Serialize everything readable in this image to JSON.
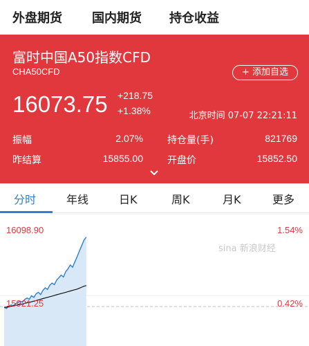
{
  "nav": {
    "tabs": [
      "外盘期货",
      "国内期货",
      "持仓收益"
    ]
  },
  "instrument": {
    "name": "富时中国A50指数CFD",
    "code": "CHA50CFD",
    "add_label": "+ 添加自选",
    "price": "16073.75",
    "change": "+218.75",
    "change_pct": "+1.38%",
    "time": "北京时间 07-07 22:21:11"
  },
  "stats": [
    {
      "label": "振幅",
      "value": "2.07%"
    },
    {
      "label": "持仓量(手)",
      "value": "821769"
    },
    {
      "label": "昨结算",
      "value": "15855.00"
    },
    {
      "label": "开盘价",
      "value": "15852.50"
    }
  ],
  "chart_tabs": [
    "分时",
    "年线",
    "日K",
    "周K",
    "月K",
    "更多"
  ],
  "chart_data": {
    "type": "line",
    "title": "",
    "xlabel": "",
    "ylabel": "",
    "ylim": [
      15744,
      16098.9
    ],
    "y_ticks_left": [
      "16098.90",
      "15921.25"
    ],
    "y_ticks_right": [
      "1.54%",
      "0.42%"
    ],
    "reference_value": 15855.0,
    "series": [
      {
        "values": [
          15852.5,
          15849,
          15856,
          15860,
          15858,
          15864,
          15868,
          15872,
          15869,
          15877,
          15882,
          15878,
          15889,
          15884,
          15895,
          15900,
          15893,
          15906,
          15914,
          15909,
          15922,
          15929,
          15924,
          15938,
          15946,
          15954,
          15948,
          15965,
          15974,
          15986,
          15979,
          15996,
          16012,
          16030,
          16047,
          16064,
          16073.75
        ]
      },
      {
        "values": [
          15852.5,
          15853,
          15854,
          15856,
          15857,
          15859,
          15860,
          15862,
          15863,
          15865,
          15867,
          15868,
          15870,
          15872,
          15874,
          15876,
          15878,
          15880,
          15882,
          15884,
          15886,
          15888,
          15890,
          15892,
          15894,
          15896,
          15898,
          15900,
          15902,
          15904,
          15906,
          15908,
          15910,
          15913,
          15916,
          15919,
          15921
        ]
      }
    ]
  },
  "watermark": "sina 新浪财经",
  "colors": {
    "panel": "#e0383c",
    "accent": "#2c7fd3",
    "avg_line": "#111111"
  }
}
